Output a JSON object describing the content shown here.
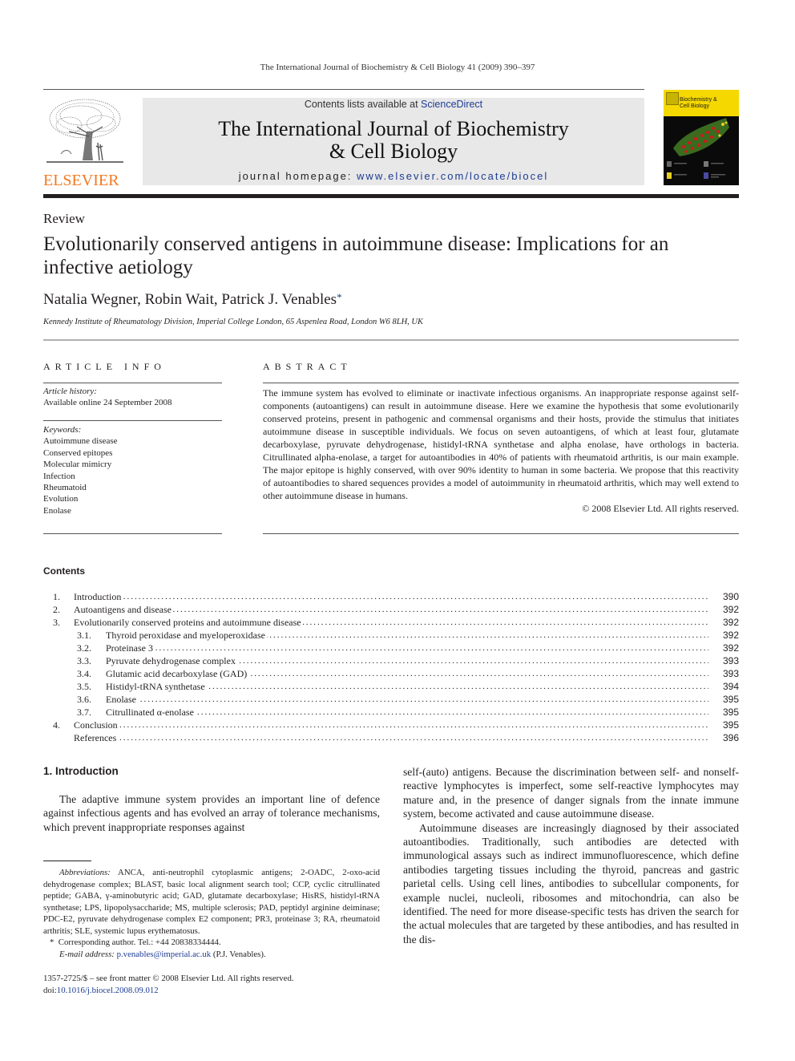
{
  "running_head": "The International Journal of Biochemistry & Cell Biology 41 (2009) 390–397",
  "masthead": {
    "contents_prefix": "Contents lists available at ",
    "contents_link": "ScienceDirect",
    "journal_title_line1": "The International Journal of Biochemistry",
    "journal_title_line2": "& Cell Biology",
    "homepage_prefix": "journal homepage: ",
    "homepage_link": "www.elsevier.com/locate/biocel",
    "publisher_logo_text": "ELSEVIER",
    "cover_title_line1": "Biochemistry &",
    "cover_title_line2": "Cell Biology",
    "brand_orange": "#f47920",
    "link_blue": "#1d3c92",
    "cover_yellow": "#f5d800"
  },
  "article": {
    "type": "Review",
    "title": "Evolutionarily conserved antigens in autoimmune disease: Implications for an infective aetiology",
    "authors": "Natalia Wegner, Robin Wait, Patrick J. Venables",
    "corresponding_marker": "*",
    "affiliation": "Kennedy Institute of Rheumatology Division, Imperial College London, 65 Aspenlea Road, London W6 8LH, UK"
  },
  "article_info": {
    "heading": "ARTICLE INFO",
    "history_label": "Article history:",
    "history_value": "Available online 24 September 2008",
    "keywords_label": "Keywords:",
    "keywords": [
      "Autoimmune disease",
      "Conserved epitopes",
      "Molecular mimicry",
      "Infection",
      "Rheumatoid",
      "Evolution",
      "Enolase"
    ]
  },
  "abstract": {
    "heading": "ABSTRACT",
    "text": "The immune system has evolved to eliminate or inactivate infectious organisms. An inappropriate response against self-components (autoantigens) can result in autoimmune disease. Here we examine the hypothesis that some evolutionarily conserved proteins, present in pathogenic and commensal organisms and their hosts, provide the stimulus that initiates autoimmune disease in susceptible individuals. We focus on seven autoantigens, of which at least four, glutamate decarboxylase, pyruvate dehydrogenase, histidyl-tRNA synthetase and alpha enolase, have orthologs in bacteria. Citrullinated alpha-enolase, a target for autoantibodies in 40% of patients with rheumatoid arthritis, is our main example. The major epitope is highly conserved, with over 90% identity to human in some bacteria. We propose that this reactivity of autoantibodies to shared sequences provides a model of autoimmunity in rheumatoid arthritis, which may well extend to other autoimmune disease in humans.",
    "copyright": "© 2008 Elsevier Ltd. All rights reserved."
  },
  "contents": {
    "heading": "Contents",
    "items": [
      {
        "num": "1.",
        "label": "Introduction",
        "page": "390",
        "level": 1
      },
      {
        "num": "2.",
        "label": "Autoantigens and disease",
        "page": "392",
        "level": 1
      },
      {
        "num": "3.",
        "label": "Evolutionarily conserved proteins and autoimmune disease",
        "page": "392",
        "level": 1
      },
      {
        "num": "3.1.",
        "label": "Thyroid peroxidase and myeloperoxidase",
        "page": "392",
        "level": 2
      },
      {
        "num": "3.2.",
        "label": "Proteinase 3",
        "page": "392",
        "level": 2
      },
      {
        "num": "3.3.",
        "label": "Pyruvate dehydrogenase complex",
        "page": "393",
        "level": 2
      },
      {
        "num": "3.4.",
        "label": "Glutamic acid decarboxylase (GAD)",
        "page": "393",
        "level": 2
      },
      {
        "num": "3.5.",
        "label": "Histidyl-tRNA synthetase",
        "page": "394",
        "level": 2
      },
      {
        "num": "3.6.",
        "label": "Enolase",
        "page": "395",
        "level": 2
      },
      {
        "num": "3.7.",
        "label": "Citrullinated α-enolase",
        "page": "395",
        "level": 2
      },
      {
        "num": "4.",
        "label": "Conclusion",
        "page": "395",
        "level": 1
      },
      {
        "num": "",
        "label": "References",
        "page": "396",
        "level": 1
      }
    ]
  },
  "introduction": {
    "heading": "1.  Introduction",
    "para1_left": "The adaptive immune system provides an important line of defence against infectious agents and has evolved an array of tolerance mechanisms, which prevent inappropriate responses against",
    "para1_right": "self-(auto) antigens. Because the discrimination between self- and nonself-reactive lymphocytes is imperfect, some self-reactive lymphocytes may mature and, in the presence of danger signals from the innate immune system, become activated and cause autoimmune disease.",
    "para2": "Autoimmune diseases are increasingly diagnosed by their associated autoantibodies. Traditionally, such antibodies are detected with immunological assays such as indirect immunofluorescence, which define antibodies targeting tissues including the thyroid, pancreas and gastric parietal cells. Using cell lines, antibodies to subcellular components, for example nuclei, nucleoli, ribosomes and mitochondria, can also be identified. The need for more disease-specific tests has driven the search for the actual molecules that are targeted by these antibodies, and has resulted in the dis-"
  },
  "footnotes": {
    "abbrev_label": "Abbreviations:",
    "abbrev_text": " ANCA, anti-neutrophil cytoplasmic antigens; 2-OADC, 2-oxo-acid dehydrogenase complex; BLAST, basic local alignment search tool; CCP, cyclic citrullinated peptide; GABA, γ-aminobutyric acid; GAD, glutamate decarboxylase; HisRS, histidyl-tRNA synthetase; LPS, lipopolysaccharide; MS, multiple sclerosis; PAD, peptidyl arginine deiminase; PDC-E2, pyruvate dehydrogenase complex E2 component; PR3, proteinase 3; RA, rheumatoid arthritis; SLE, systemic lupus erythematosus.",
    "corresponding": "Corresponding author. Tel.: +44 20838334444.",
    "email_label": "E-mail address:",
    "email": "p.venables@imperial.ac.uk",
    "email_suffix": " (P.J. Venables).",
    "front_matter": "1357-2725/$ – see front matter © 2008 Elsevier Ltd. All rights reserved.",
    "doi_prefix": "doi:",
    "doi": "10.1016/j.biocel.2008.09.012"
  }
}
